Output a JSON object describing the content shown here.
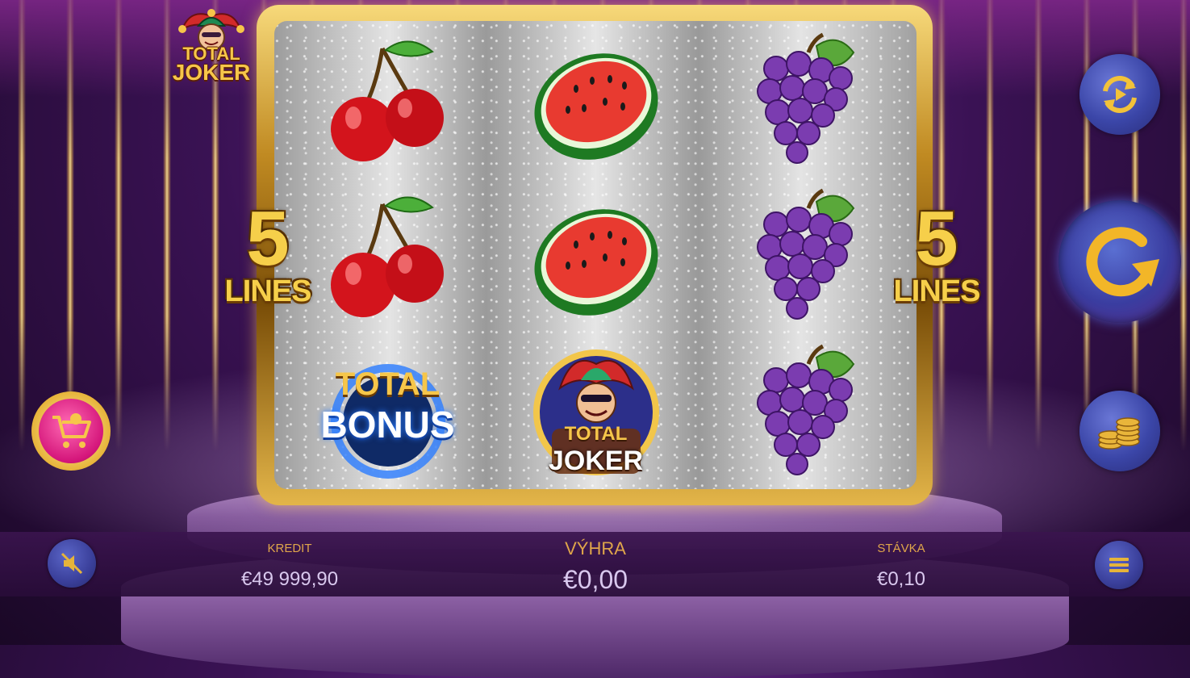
{
  "game": {
    "logo_line1": "TOTAL",
    "logo_line2": "JOKER"
  },
  "paylines": {
    "left_count": "5",
    "left_label": "LINES",
    "right_count": "5",
    "right_label": "LINES"
  },
  "reels": {
    "grid": [
      [
        "cherry",
        "watermelon",
        "grapes"
      ],
      [
        "cherry",
        "watermelon",
        "grapes"
      ],
      [
        "total-bonus",
        "total-joker",
        "grapes"
      ]
    ],
    "bonus_symbol": {
      "line1": "TOTAL",
      "line2": "BONUS"
    },
    "joker_symbol": {
      "line1": "TOTAL",
      "line2": "JOKER"
    }
  },
  "controls": {
    "autoplay_icon": "autoplay-icon",
    "spin_icon": "spin-icon",
    "bet_icon": "coins-icon",
    "shop_icon": "shopping-cart-icon",
    "sound_icon": "sound-muted-icon",
    "menu_icon": "menu-icon"
  },
  "bottom_bar": {
    "credit_label": "KREDIT",
    "credit_value": "€49 999,90",
    "win_label": "VÝHRA",
    "win_value": "€0,00",
    "bet_label": "STÁVKA",
    "bet_value": "€0,10"
  },
  "colors": {
    "gold": "#f6cf4a",
    "bar_label": "#e0a64a",
    "bar_value": "#d9c8ee",
    "button_blue": "#3b46a8",
    "shop_pink": "#d4157a"
  }
}
